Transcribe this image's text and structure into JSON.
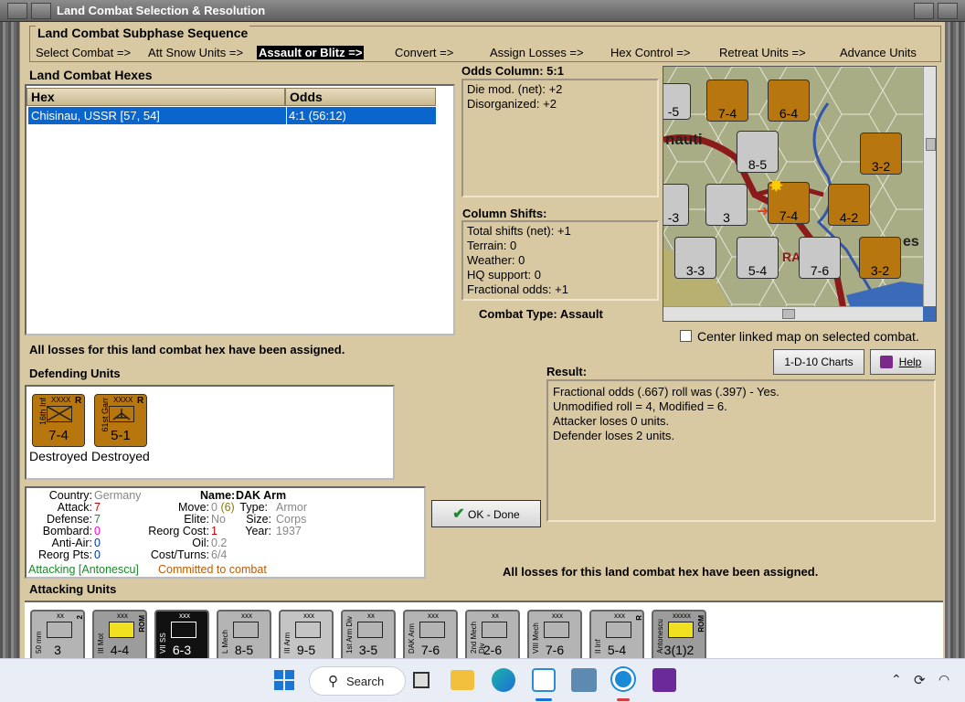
{
  "window": {
    "title": "Land Combat Selection & Resolution"
  },
  "sequence": {
    "heading": "Land Combat Subphase Sequence",
    "steps": [
      "Select Combat =>",
      "Att Snow Units =>",
      "Assault or Blitz =>",
      "Convert =>",
      "Assign Losses =>",
      "Hex Control =>",
      "Retreat Units =>",
      "Advance Units"
    ],
    "active_index": 2
  },
  "hexes": {
    "heading": "Land Combat Hexes",
    "columns": [
      "Hex",
      "Odds"
    ],
    "rows": [
      {
        "hex": "Chisinau, USSR [57, 54]",
        "odds": "4:1 (56:12)"
      }
    ]
  },
  "odds": {
    "heading": "Odds Column: 5:1",
    "lines": [
      "Die mod. (net): +2",
      "Disorganized: +2"
    ]
  },
  "shifts": {
    "heading": "Column Shifts:",
    "lines": [
      "Total shifts (net): +1",
      "Terrain: 0",
      "Weather: 0",
      "HQ support: 0",
      "Fractional odds: +1"
    ]
  },
  "combat_type": "Combat Type:  Assault",
  "center_map_label": "Center linked map on selected combat.",
  "losses_msg": "All losses for this land combat hex have been assigned.",
  "losses_msg2": "All losses for this land combat hex have been assigned.",
  "buttons": {
    "charts": "1-D-10 Charts",
    "help": "Help",
    "ok": "OK - Done"
  },
  "defending": {
    "heading": "Defending Units",
    "units": [
      {
        "name": "16th Inf",
        "size": "XXXX",
        "str": "7-4",
        "status": "Destroyed",
        "badge": "R"
      },
      {
        "name": "61st Garr",
        "size": "XXXX",
        "str": "5-1",
        "status": "Destroyed",
        "badge": "R"
      }
    ]
  },
  "result": {
    "heading": "Result:",
    "lines": [
      "Fractional odds (.667) roll was (.397)  - Yes.",
      "Unmodified roll = 4, Modified = 6.",
      "Attacker loses 0 units.",
      "Defender loses 2 units."
    ]
  },
  "unit_info": {
    "country_label": "Country:",
    "country": "Germany",
    "attack_label": "Attack:",
    "attack": "7",
    "defense_label": "Defense:",
    "defense": "7",
    "bombard_label": "Bombard:",
    "bombard": "0",
    "antiair_label": "Anti-Air:",
    "antiair": "0",
    "reorg_label": "Reorg Pts:",
    "reorg": "0",
    "name_label": "Name:",
    "name": "DAK Arm",
    "move_label": "Move:",
    "move": "0",
    "move_paren": "(6)",
    "type_label": "Type:",
    "type": "Armor",
    "elite_label": "Elite:",
    "elite": "No",
    "size_label": "Size:",
    "size": "Corps",
    "reorgcost_label": "Reorg Cost:",
    "reorgcost": "1",
    "year_label": "Year:",
    "year": "1937",
    "oil_label": "Oil:",
    "oil": "0.2",
    "cost_label": "Cost/Turns:",
    "cost": "6/4",
    "attacking_label": "Attacking [Antonescu]",
    "committed": "Committed to combat"
  },
  "attacking": {
    "heading": "Attacking Units",
    "units": [
      {
        "name": "50 mm",
        "size": "xx",
        "str": "3",
        "bg": "#b4b4b4",
        "badge": "2"
      },
      {
        "name": "III Mot",
        "size": "xxx",
        "str": "4-4",
        "bg": "#9c9c9c",
        "badge": "ROM"
      },
      {
        "name": "VII SS",
        "size": "xxx",
        "str": "6-3",
        "bg": "#111111",
        "badge": ""
      },
      {
        "name": "L Mech",
        "size": "xxx",
        "str": "8-5",
        "bg": "#b4b4b4",
        "badge": ""
      },
      {
        "name": "III Arm",
        "size": "xxx",
        "str": "9-5",
        "bg": "#c4c4c4",
        "badge": ""
      },
      {
        "name": "1st Arm Div",
        "size": "xx",
        "str": "3-5",
        "bg": "#b4b4b4",
        "badge": ""
      },
      {
        "name": "DAK Arm",
        "size": "xxx",
        "str": "7-6",
        "bg": "#b4b4b4",
        "badge": ""
      },
      {
        "name": "2nd Mech Div",
        "size": "xx",
        "str": "2-6",
        "bg": "#b4b4b4",
        "badge": ""
      },
      {
        "name": "VIII Mech",
        "size": "xxx",
        "str": "7-6",
        "bg": "#b4b4b4",
        "badge": ""
      },
      {
        "name": "II Inf",
        "size": "xxx",
        "str": "5-4",
        "bg": "#b4b4b4",
        "badge": "R"
      },
      {
        "name": "Antonescu",
        "size": "xxxxx",
        "str": "3(1)2",
        "bg": "#9c9c9c",
        "badge": "ROM"
      }
    ]
  },
  "map": {
    "place": "nauti",
    "place2": "RA",
    "place3": "es",
    "counters": [
      {
        "str": "-5",
        "fill": "#c8c8c8"
      },
      {
        "str": "7-4",
        "fill": "#b8760e"
      },
      {
        "str": "6-4",
        "fill": "#b8760e"
      },
      {
        "str": "8-5",
        "fill": "#c8c8c8"
      },
      {
        "str": "3-2",
        "fill": "#b8760e"
      },
      {
        "str": "-3",
        "fill": "#c8c8c8"
      },
      {
        "str": "3",
        "fill": "#c8c8c8"
      },
      {
        "str": "7-4",
        "fill": "#b8760e"
      },
      {
        "str": "4-2",
        "fill": "#b8760e"
      },
      {
        "str": "3-3",
        "fill": "#c8c8c8"
      },
      {
        "str": "5-4",
        "fill": "#c8c8c8"
      },
      {
        "str": "7-6",
        "fill": "#c8c8c8"
      },
      {
        "str": "3-2",
        "fill": "#b8760e"
      }
    ]
  },
  "taskbar": {
    "search": "Search"
  },
  "colors": {
    "panel": "#d9c9a3",
    "axis_brown": "#b8760e",
    "selection": "#0a66cc"
  }
}
